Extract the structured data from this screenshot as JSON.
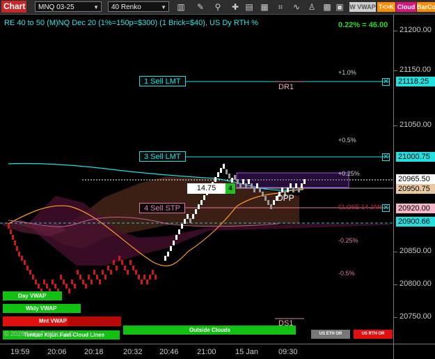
{
  "toolbar": {
    "title": "Chart",
    "instrument": "MNQ 03-25",
    "bar_type": "40 Renko",
    "icons": [
      "bars-icon",
      "pencil-icon",
      "zoom-icon",
      "crosshair-icon",
      "properties-icon",
      "templates-icon",
      "drawing-tools-icon",
      "indicators-icon",
      "strategies-icon"
    ],
    "btn_vwap": "W VWAP",
    "btn_tk": "T<>K",
    "btn_cloud": "Cloud",
    "btn_barcolor": "BarCo"
  },
  "chart": {
    "title": "RE 40 to 50 (M)NQ Dec 20 (1%=150p=$300) (1 Brick=$40), US Dy RTH %",
    "pct_readout": "0.22% = 46.00",
    "levels": {
      "p1": "+1.0%",
      "p05": "+0.5%",
      "p025": "+0.25%",
      "close": "CLOSE 14 JAN",
      "m025": "-0.25%",
      "m05": "-0.5%"
    },
    "orders": {
      "sell_lmt_1": "1 Sell LMT",
      "sell_lmt_3": "3 Sell LMT",
      "sell_stp_4": "4 Sell STP",
      "close_x": "✕"
    },
    "position": {
      "price_diff": "14.75",
      "qty": "4"
    },
    "dpp": "DPP",
    "dr1": "DR1",
    "ds1": "DS1",
    "buttons": {
      "day_vwap": "Day VWAP",
      "wkly_vwap": "Wkly VWAP",
      "mnt_vwap": "Mnt VWAP",
      "tenkan": "Tenkan Kijun Fast Cloud Lines",
      "outside_clouds": "Outside Clouds",
      "us_eth_or": "US ETH OR",
      "us_rth_or": "US RTH OR"
    },
    "copyright": "© 2025 NinjaTrader, LLC"
  },
  "y_axis": {
    "ticks": [
      "21200.00",
      "21150.00",
      "21050.00",
      "20850.00",
      "20800.00",
      "20750.00"
    ],
    "badges": {
      "sell_lmt_1": "21118.25",
      "sell_lmt_3": "21000.75",
      "last": "20965.50",
      "avg": "20950.75",
      "stop": "20920.00",
      "close": "20900.66"
    }
  },
  "x_axis": {
    "ticks": [
      "19:59",
      "20:06",
      "20:18",
      "20:32",
      "20:46",
      "21:00",
      "15 Jan",
      "09:30"
    ]
  },
  "colors": {
    "bull_brick": "#ffffff",
    "bear_brick": "#d01818",
    "cyan": "#22e0e0",
    "pink": "#e07aa0",
    "orange": "#ff9a2a",
    "accent_green": "#1fc21f"
  }
}
